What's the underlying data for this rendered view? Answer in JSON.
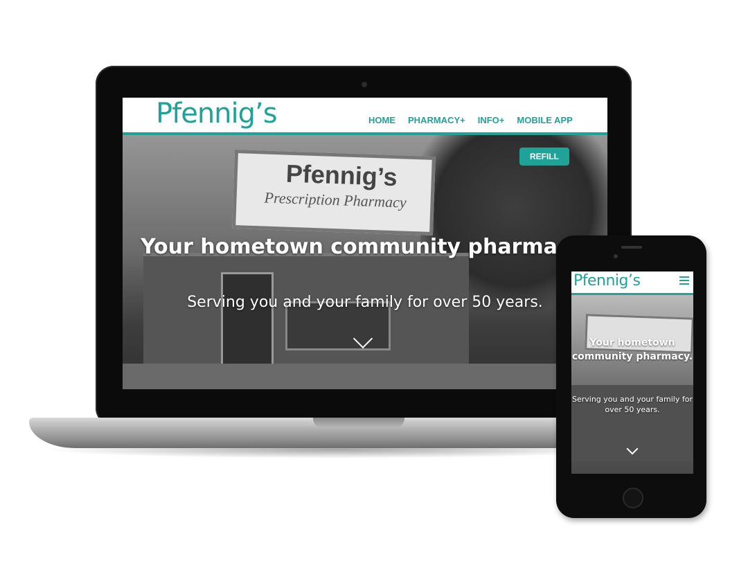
{
  "brand": {
    "logo_text": "Pfennig’s",
    "accent_color": "#1fa399"
  },
  "desktop": {
    "nav": {
      "items": [
        {
          "label": "HOME"
        },
        {
          "label": "PHARMACY+"
        },
        {
          "label": "INFO+"
        },
        {
          "label": "MOBILE APP"
        }
      ]
    },
    "refill_label": "REFILL",
    "hero": {
      "sign_line1": "Pfennig’s",
      "sign_line2": "Prescription Pharmacy",
      "headline": "Your hometown community pharmacy.",
      "subheadline": "Serving you and your family for over 50 years."
    }
  },
  "mobile": {
    "logo_text": "Pfennig’s",
    "menu_icon": "hamburger-icon",
    "hero": {
      "headline": "Your hometown community pharmacy.",
      "subheadline": "Serving you and your family for over 50 years."
    }
  },
  "icons": {
    "scroll_down": "chevron-down-icon"
  }
}
